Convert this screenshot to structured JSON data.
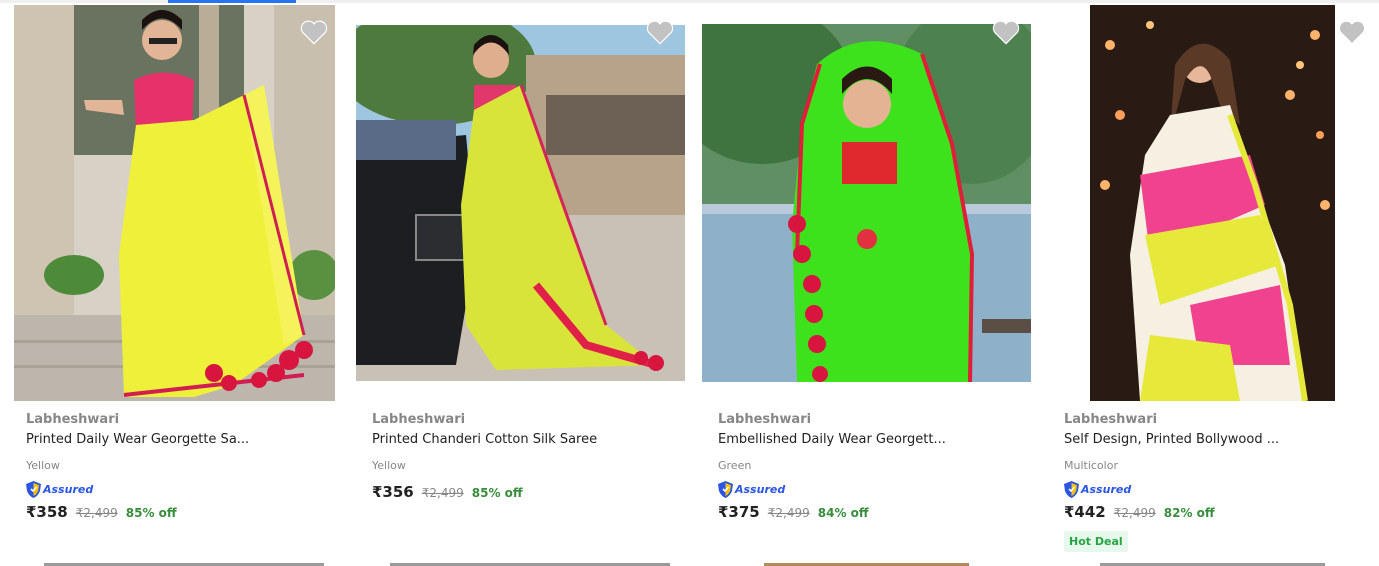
{
  "products": [
    {
      "brand": "Labheshwari",
      "title": "Printed Daily Wear Georgette Sa...",
      "color": "Yellow",
      "assured": true,
      "price": "₹358",
      "mrp": "₹2,499",
      "discount": "85% off",
      "image_alt": "Woman in yellow georgette saree with red pom-pom border",
      "saree_color": "#eef03a"
    },
    {
      "brand": "Labheshwari",
      "title": "Printed Chanderi Cotton Silk Saree",
      "color": "Yellow",
      "assured": false,
      "price": "₹356",
      "mrp": "₹2,499",
      "discount": "85% off",
      "image_alt": "Woman in yellow chanderi saree standing near a black car",
      "saree_color": "#d9e43a"
    },
    {
      "brand": "Labheshwari",
      "title": "Embellished Daily Wear Georgett...",
      "color": "Green",
      "assured": true,
      "price": "₹375",
      "mrp": "₹2,499",
      "discount": "84% off",
      "image_alt": "Woman in bright green georgette saree with red border",
      "saree_color": "#3ee21c"
    },
    {
      "brand": "Labheshwari",
      "title": "Self Design, Printed Bollywood ...",
      "color": "Multicolor",
      "assured": true,
      "price": "₹442",
      "mrp": "₹2,499",
      "discount": "82% off",
      "badge": "Hot Deal",
      "image_alt": "Woman in multicolor pink, yellow and white saree with bokeh lights",
      "saree_color": "#f0428f"
    }
  ],
  "assured_label": "Assured",
  "colors": {
    "accent": "#2874f0",
    "brand_grey": "#878787",
    "discount_green": "#388e3c",
    "assured_blue": "#2a55e5",
    "heart_grey": "#c2c2c2",
    "hot_deal_bg": "#e7f8ec"
  },
  "icons": [
    "heart-icon",
    "assured-shield-icon"
  ]
}
